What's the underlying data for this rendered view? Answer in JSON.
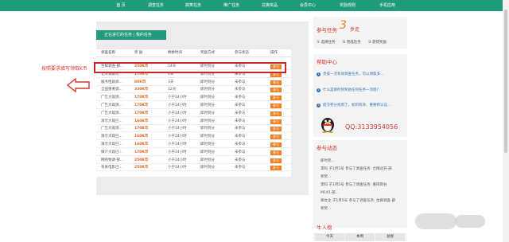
{
  "nav": [
    "首 页",
    "调查任务",
    "搞笑任务",
    "推广任务",
    "兑换奖品",
    "会员中心",
    "奖励规则",
    "手机应用"
  ],
  "page_title": "正在进行的任务 | 我的任务",
  "annotation": "按照要求填写领取K币",
  "table": {
    "headers": [
      "调查名称",
      "奖 励",
      "剩余时间",
      "奖励方式",
      "参与状态",
      "操作"
    ],
    "rows": [
      {
        "name": "生鲜调查-部...",
        "reward": "250K币",
        "time": "14天",
        "method": "即时到分",
        "status": "未参与",
        "action": "参与"
      },
      {
        "name": "北斗观察问...",
        "reward": "170K币",
        "time": "4天",
        "method": "即时到分",
        "status": "未参与",
        "action": "参与"
      },
      {
        "name": "服务性质调...",
        "reward": "80K币",
        "time": "3天",
        "method": "即时到分",
        "status": "未参与",
        "action": "参与"
      },
      {
        "name": "全国重要调...",
        "reward": "330K币",
        "time": "12天",
        "method": "即时到分",
        "status": "未参与",
        "action": "参与"
      },
      {
        "name": "广告大观测...",
        "reward": "170K币",
        "time": "小于24小时",
        "method": "即时到分",
        "status": "未参与",
        "action": "参与"
      },
      {
        "name": "广告大观测...",
        "reward": "170K币",
        "time": "小于24小时",
        "method": "即时到分",
        "status": "未参与",
        "action": "参与"
      },
      {
        "name": "广告大观测...",
        "reward": "170K币",
        "time": "小于24小时",
        "method": "即时到分",
        "status": "未参与",
        "action": "参与"
      },
      {
        "name": "演示大观已...",
        "reward": "160K币",
        "time": "小于24小时",
        "method": "即时到分",
        "status": "未参与",
        "action": "参与"
      },
      {
        "name": "广告大观测...",
        "reward": "170K币",
        "time": "小于24小时",
        "method": "即时到分",
        "status": "未参与",
        "action": "参与"
      },
      {
        "name": "演示大观已...",
        "reward": "160K币",
        "time": "小于24小时",
        "method": "即时到分",
        "status": "未参与",
        "action": "参与"
      },
      {
        "name": "演示大观已...",
        "reward": "160K币",
        "time": "小于24小时",
        "method": "即时到分",
        "status": "未参与",
        "action": "参与"
      },
      {
        "name": "媒介大观已...",
        "reward": "170K币",
        "time": "小于24小时",
        "method": "即时到分",
        "status": "未参与",
        "action": "参与"
      },
      {
        "name": "网购物调-部...",
        "reward": "250K币",
        "time": "小于24小时",
        "method": "即时到分",
        "status": "未参与",
        "action": "参与"
      },
      {
        "name": "有关电影已...",
        "reward": "250K币",
        "time": "小于24小时",
        "method": "即时到分",
        "status": "未参与",
        "action": "参与"
      }
    ]
  },
  "right": {
    "task_title": "参与任务",
    "task_num": "3",
    "task_suffix": "步走",
    "steps": [
      "① 选择任务",
      "② 完成任务",
      "③ 获得奖励"
    ],
    "help_title": "帮助中心",
    "help_items": [
      "完成一次有效调查任务，可以领取多...",
      "什么是即时到奖励任何任务一流程?",
      "提交积分找到了，如何有效，重要积认证..."
    ],
    "qq_label": "QQ:3133954056",
    "activity_title": "参与动态",
    "activity": [
      "即时奖...",
      "李科 子1月5号 参与了调查任务: 仓储过开-部",
      "积奖...",
      "李科 子1月5号 参与了调查任务: 重阳到谷",
      "M145-部...",
      "郑女主 子1月5号 参与了调查任务: 生鲜调查-部",
      "积奖..."
    ],
    "rank_title": "牛人榜",
    "rank_tabs": [
      "今天",
      "本周",
      "总榜"
    ]
  }
}
